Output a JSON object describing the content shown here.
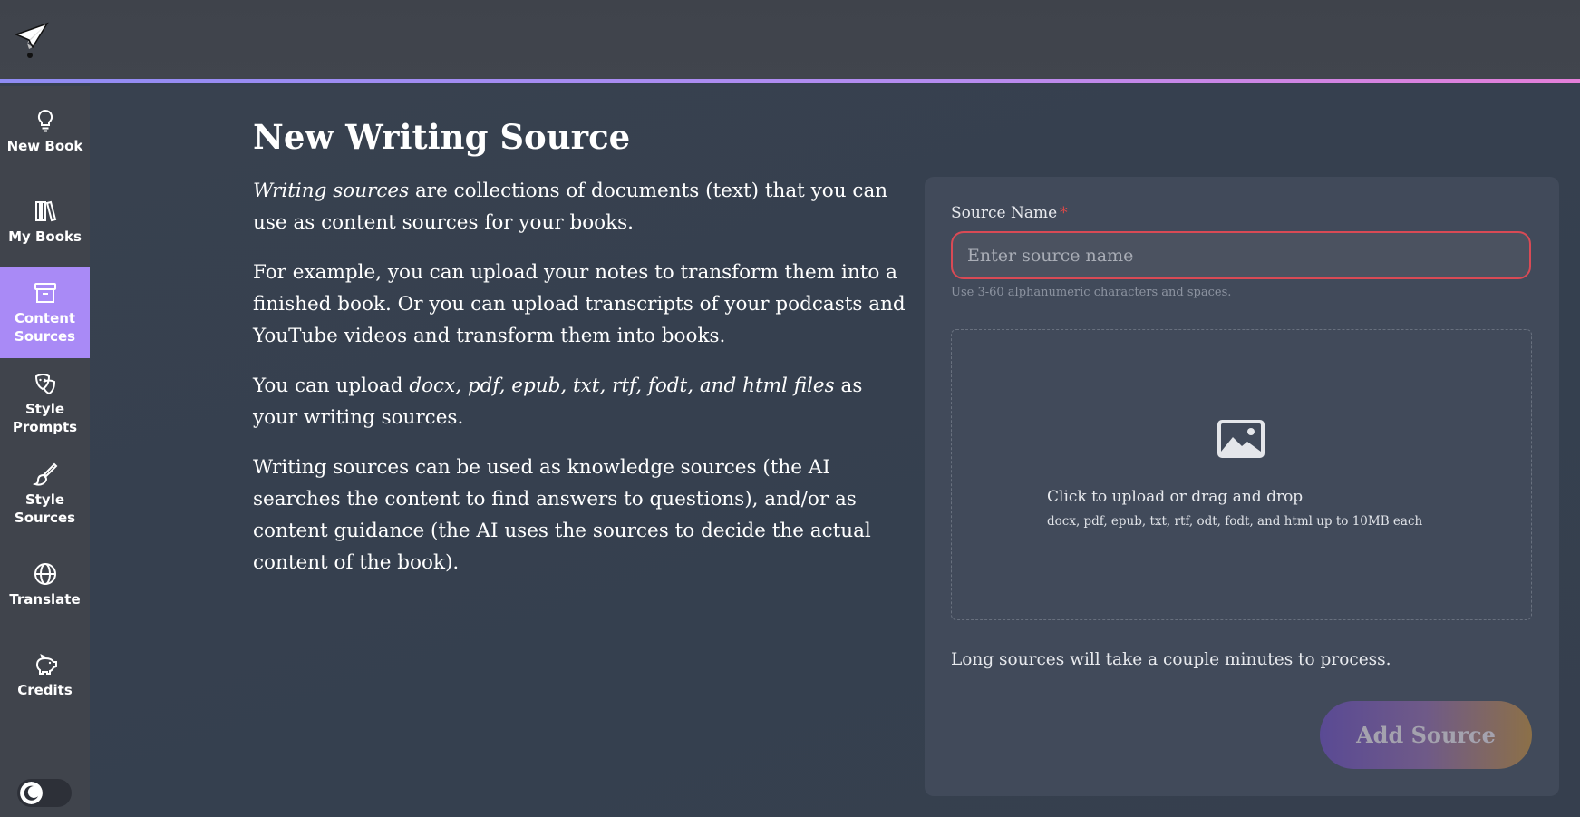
{
  "brand": {
    "logo_icon": "paper-plane-icon"
  },
  "sidebar": {
    "items": [
      {
        "label": "New Book",
        "icon": "lightbulb-icon",
        "active": false
      },
      {
        "label": "My Books",
        "icon": "books-icon",
        "active": false
      },
      {
        "label": "Content Sources",
        "icon": "archive-box-icon",
        "active": true
      },
      {
        "label": "Style Prompts",
        "icon": "theater-masks-icon",
        "active": false
      },
      {
        "label": "Style Sources",
        "icon": "paint-brush-icon",
        "active": false
      },
      {
        "label": "Translate",
        "icon": "globe-icon",
        "active": false
      },
      {
        "label": "Credits",
        "icon": "piggy-bank-icon",
        "active": false
      }
    ],
    "theme_toggle_icon": "moon-icon"
  },
  "main": {
    "title": "New Writing Source",
    "description": {
      "p1_em": "Writing sources",
      "p1_rest": " are collections of documents (text) that you can use as content sources for your books.",
      "p2": "For example, you can upload your notes to transform them into a finished book. Or you can upload transcripts of your podcasts and YouTube videos and transform them into books.",
      "p3_pre": "You can upload ",
      "p3_em": "docx, pdf, epub, txt, rtf, fodt, and html files",
      "p3_post": " as your writing sources.",
      "p4": "Writing sources can be used as knowledge sources (the AI searches the content to find answers to questions), and/or as content guidance (the AI uses the sources to decide the actual content of the book)."
    }
  },
  "form": {
    "source_name_label": "Source Name",
    "required_marker": "*",
    "source_name_value": "",
    "source_name_placeholder": "Enter source name",
    "source_name_hint": "Use 3-60 alphanumeric characters and spaces.",
    "upload": {
      "icon": "image-icon",
      "main_text": "Click to upload or drag and drop",
      "sub_text": "docx, pdf, epub, txt, rtf, odt, fodt, and html up to 10MB each"
    },
    "processing_note": "Long sources will take a couple minutes to process.",
    "submit_label": "Add Source"
  },
  "colors": {
    "active_nav": "#a98af6",
    "error_border": "#d94a55",
    "required": "#e04848"
  }
}
